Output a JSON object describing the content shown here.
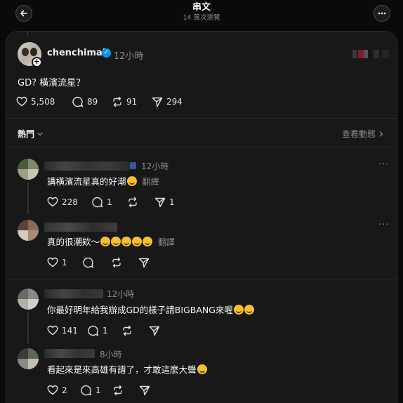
{
  "header": {
    "title": "串文",
    "views": "14 萬次瀏覽",
    "back_icon": "arrow-left-icon",
    "more_icon": "ellipsis-icon"
  },
  "post": {
    "author": "chenchimai",
    "verified": true,
    "time": "12小時",
    "text": "GD? 橫濱流星？",
    "likes": "5,508",
    "comments": "89",
    "reposts": "91",
    "shares": "294"
  },
  "sort": {
    "label": "熱門",
    "activity_link": "查看動態"
  },
  "comments": [
    {
      "time": "12小時",
      "text": "講橫濱流星真的好潮",
      "translate": "翻譯",
      "likes": "228",
      "replies": "1",
      "reposts": "",
      "shares": "1",
      "emoji_count": 1
    },
    {
      "time": "",
      "text": "真的很潮欸～",
      "translate": "翻譯",
      "likes": "1",
      "replies": "",
      "reposts": "",
      "shares": "",
      "emoji_count": 5
    },
    {
      "time": "12小時",
      "text": "你最好明年給我辦成GD的樣子請BIGBANG來喔",
      "translate": "",
      "likes": "141",
      "replies": "1",
      "reposts": "",
      "shares": "",
      "emoji_count": 2
    },
    {
      "time": "8小時",
      "text": "看起來是來高雄有譜了，才敢這麼大聲",
      "translate": "",
      "likes": "2",
      "replies": "1",
      "reposts": "",
      "shares": "",
      "emoji_count": 1
    }
  ],
  "colors": {
    "background": "#0a0a0a",
    "card": "#181818",
    "text": "#f3f5f7",
    "muted": "#8a8a8a",
    "verified": "#0095f6"
  }
}
